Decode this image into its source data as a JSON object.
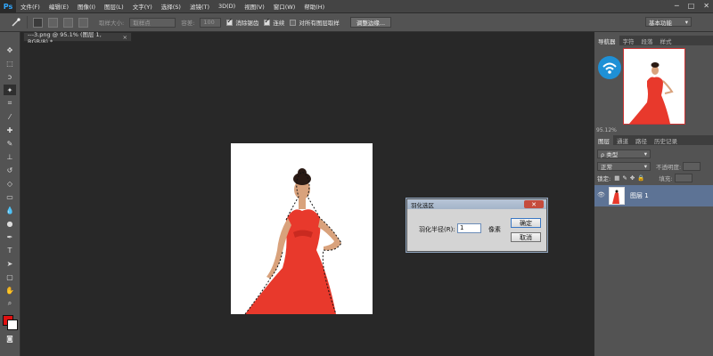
{
  "app": {
    "logo": "Ps",
    "window_controls": [
      "─",
      "□",
      "✕"
    ]
  },
  "menu": [
    "文件(F)",
    "编辑(E)",
    "图像(I)",
    "图层(L)",
    "文字(Y)",
    "选择(S)",
    "滤镜(T)",
    "3D(D)",
    "视图(V)",
    "窗口(W)",
    "帮助(H)"
  ],
  "options_bar": {
    "sample_size_label": "取样大小:",
    "sample_size_value": "取样点",
    "tolerance_label": "容差:",
    "tolerance_value": "100",
    "antialias_label": "消除锯齿",
    "contiguous_label": "连续",
    "sample_all_label": "对所有图层取样",
    "refine_edge_label": "调整边缘...",
    "workspace_label": "基本功能"
  },
  "document": {
    "tab_title": "---3.png @ 95.1% (图层 1, RGB/8) *",
    "close": "×"
  },
  "feather_dialog": {
    "title": "羽化选区",
    "close": "✕",
    "radius_label": "羽化半径(R):",
    "radius_value": "1",
    "unit": "像素",
    "ok": "确定",
    "cancel": "取消"
  },
  "navigator": {
    "tabs": [
      "导航器",
      "字符",
      "段落",
      "样式"
    ],
    "zoom": "95.12%"
  },
  "layers_panel": {
    "tabs": [
      "图层",
      "通道",
      "路径",
      "历史记录"
    ],
    "filter_label": "ρ 类型",
    "blend_mode": "正常",
    "opacity_label": "不透明度:",
    "lock_label": "锁定:",
    "fill_label": "填充:",
    "layer_name": "图层 1"
  },
  "colors": {
    "foreground": "#e01010",
    "background": "#ffffff",
    "accent": "#31a8ff"
  }
}
